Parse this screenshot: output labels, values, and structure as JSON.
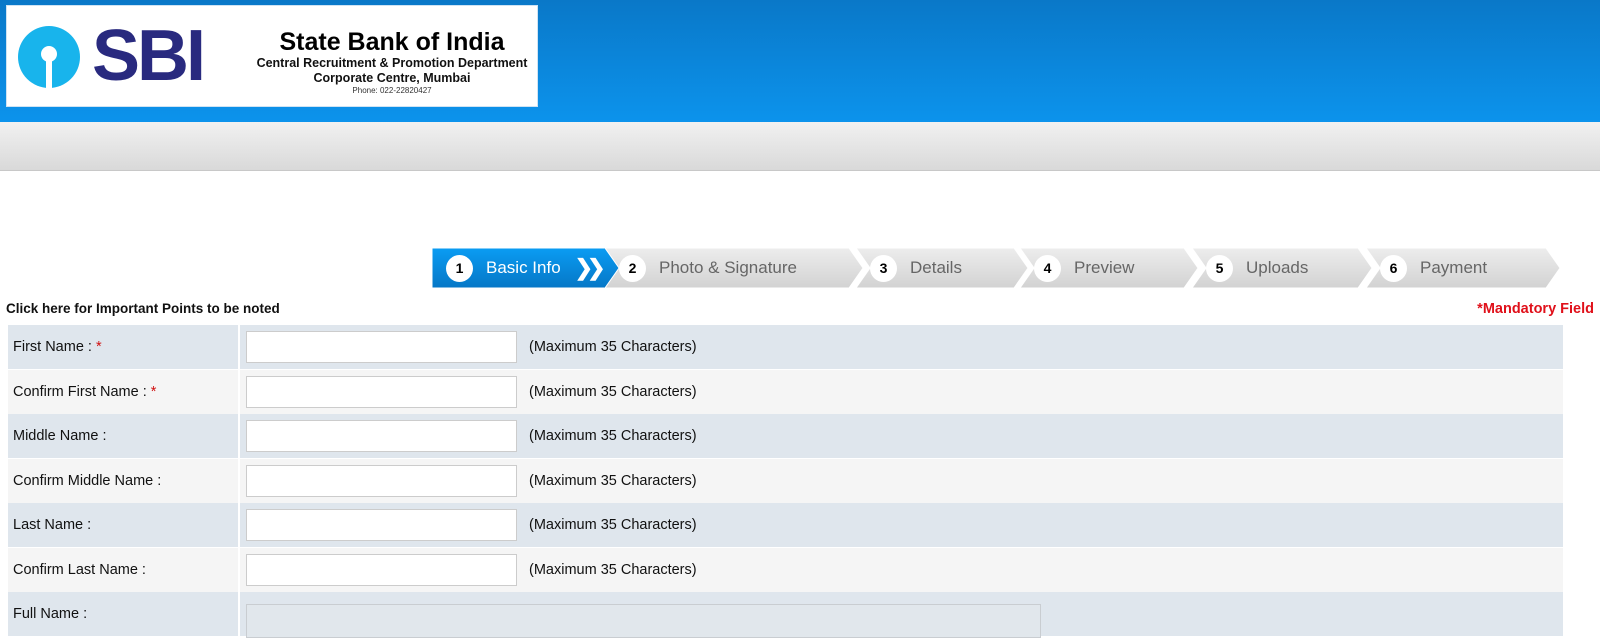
{
  "header": {
    "logo_text": "SBI",
    "bank_name": "State Bank of India",
    "department": "Central Recruitment & Promotion Department",
    "office": "Corporate Centre, Mumbai",
    "phone": "Phone: 022-22820427",
    "colors": {
      "header_blue": "#0c93ec",
      "logo_navy": "#292a7f",
      "logo_cyan": "#18b4ec"
    }
  },
  "steps": [
    {
      "num": "1",
      "label": "Basic Info",
      "active": true
    },
    {
      "num": "2",
      "label": "Photo & Signature"
    },
    {
      "num": "3",
      "label": "Details"
    },
    {
      "num": "4",
      "label": "Preview"
    },
    {
      "num": "5",
      "label": "Uploads"
    },
    {
      "num": "6",
      "label": "Payment"
    }
  ],
  "important_link": "Click here for Important Points to be noted",
  "mandatory_note": "*Mandatory Field",
  "form": {
    "required_mark": "*",
    "hint": "(Maximum 35 Characters)",
    "rows": [
      {
        "label": "First Name :",
        "required": true,
        "value": ""
      },
      {
        "label": "Confirm First Name :",
        "required": true,
        "value": ""
      },
      {
        "label": "Middle Name :",
        "value": ""
      },
      {
        "label": "Confirm Middle Name :",
        "value": ""
      },
      {
        "label": "Last Name :",
        "value": ""
      },
      {
        "label": "Confirm Last Name :",
        "value": ""
      },
      {
        "label": "Full Name :",
        "value": ""
      }
    ]
  }
}
